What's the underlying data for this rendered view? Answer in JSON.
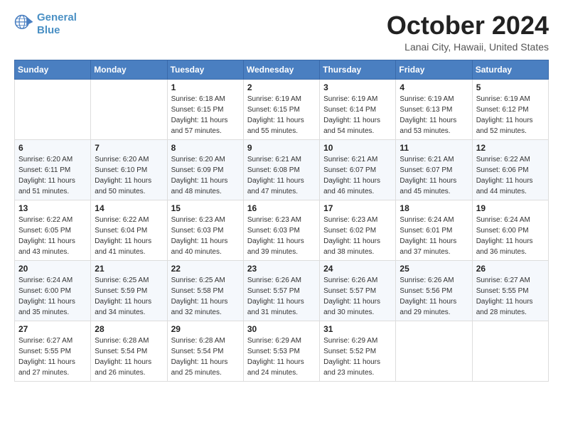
{
  "header": {
    "logo_line1": "General",
    "logo_line2": "Blue",
    "month_title": "October 2024",
    "subtitle": "Lanai City, Hawaii, United States"
  },
  "days_of_week": [
    "Sunday",
    "Monday",
    "Tuesday",
    "Wednesday",
    "Thursday",
    "Friday",
    "Saturday"
  ],
  "weeks": [
    [
      {
        "num": "",
        "detail": ""
      },
      {
        "num": "",
        "detail": ""
      },
      {
        "num": "1",
        "detail": "Sunrise: 6:18 AM\nSunset: 6:15 PM\nDaylight: 11 hours and 57 minutes."
      },
      {
        "num": "2",
        "detail": "Sunrise: 6:19 AM\nSunset: 6:15 PM\nDaylight: 11 hours and 55 minutes."
      },
      {
        "num": "3",
        "detail": "Sunrise: 6:19 AM\nSunset: 6:14 PM\nDaylight: 11 hours and 54 minutes."
      },
      {
        "num": "4",
        "detail": "Sunrise: 6:19 AM\nSunset: 6:13 PM\nDaylight: 11 hours and 53 minutes."
      },
      {
        "num": "5",
        "detail": "Sunrise: 6:19 AM\nSunset: 6:12 PM\nDaylight: 11 hours and 52 minutes."
      }
    ],
    [
      {
        "num": "6",
        "detail": "Sunrise: 6:20 AM\nSunset: 6:11 PM\nDaylight: 11 hours and 51 minutes."
      },
      {
        "num": "7",
        "detail": "Sunrise: 6:20 AM\nSunset: 6:10 PM\nDaylight: 11 hours and 50 minutes."
      },
      {
        "num": "8",
        "detail": "Sunrise: 6:20 AM\nSunset: 6:09 PM\nDaylight: 11 hours and 48 minutes."
      },
      {
        "num": "9",
        "detail": "Sunrise: 6:21 AM\nSunset: 6:08 PM\nDaylight: 11 hours and 47 minutes."
      },
      {
        "num": "10",
        "detail": "Sunrise: 6:21 AM\nSunset: 6:07 PM\nDaylight: 11 hours and 46 minutes."
      },
      {
        "num": "11",
        "detail": "Sunrise: 6:21 AM\nSunset: 6:07 PM\nDaylight: 11 hours and 45 minutes."
      },
      {
        "num": "12",
        "detail": "Sunrise: 6:22 AM\nSunset: 6:06 PM\nDaylight: 11 hours and 44 minutes."
      }
    ],
    [
      {
        "num": "13",
        "detail": "Sunrise: 6:22 AM\nSunset: 6:05 PM\nDaylight: 11 hours and 43 minutes."
      },
      {
        "num": "14",
        "detail": "Sunrise: 6:22 AM\nSunset: 6:04 PM\nDaylight: 11 hours and 41 minutes."
      },
      {
        "num": "15",
        "detail": "Sunrise: 6:23 AM\nSunset: 6:03 PM\nDaylight: 11 hours and 40 minutes."
      },
      {
        "num": "16",
        "detail": "Sunrise: 6:23 AM\nSunset: 6:03 PM\nDaylight: 11 hours and 39 minutes."
      },
      {
        "num": "17",
        "detail": "Sunrise: 6:23 AM\nSunset: 6:02 PM\nDaylight: 11 hours and 38 minutes."
      },
      {
        "num": "18",
        "detail": "Sunrise: 6:24 AM\nSunset: 6:01 PM\nDaylight: 11 hours and 37 minutes."
      },
      {
        "num": "19",
        "detail": "Sunrise: 6:24 AM\nSunset: 6:00 PM\nDaylight: 11 hours and 36 minutes."
      }
    ],
    [
      {
        "num": "20",
        "detail": "Sunrise: 6:24 AM\nSunset: 6:00 PM\nDaylight: 11 hours and 35 minutes."
      },
      {
        "num": "21",
        "detail": "Sunrise: 6:25 AM\nSunset: 5:59 PM\nDaylight: 11 hours and 34 minutes."
      },
      {
        "num": "22",
        "detail": "Sunrise: 6:25 AM\nSunset: 5:58 PM\nDaylight: 11 hours and 32 minutes."
      },
      {
        "num": "23",
        "detail": "Sunrise: 6:26 AM\nSunset: 5:57 PM\nDaylight: 11 hours and 31 minutes."
      },
      {
        "num": "24",
        "detail": "Sunrise: 6:26 AM\nSunset: 5:57 PM\nDaylight: 11 hours and 30 minutes."
      },
      {
        "num": "25",
        "detail": "Sunrise: 6:26 AM\nSunset: 5:56 PM\nDaylight: 11 hours and 29 minutes."
      },
      {
        "num": "26",
        "detail": "Sunrise: 6:27 AM\nSunset: 5:55 PM\nDaylight: 11 hours and 28 minutes."
      }
    ],
    [
      {
        "num": "27",
        "detail": "Sunrise: 6:27 AM\nSunset: 5:55 PM\nDaylight: 11 hours and 27 minutes."
      },
      {
        "num": "28",
        "detail": "Sunrise: 6:28 AM\nSunset: 5:54 PM\nDaylight: 11 hours and 26 minutes."
      },
      {
        "num": "29",
        "detail": "Sunrise: 6:28 AM\nSunset: 5:54 PM\nDaylight: 11 hours and 25 minutes."
      },
      {
        "num": "30",
        "detail": "Sunrise: 6:29 AM\nSunset: 5:53 PM\nDaylight: 11 hours and 24 minutes."
      },
      {
        "num": "31",
        "detail": "Sunrise: 6:29 AM\nSunset: 5:52 PM\nDaylight: 11 hours and 23 minutes."
      },
      {
        "num": "",
        "detail": ""
      },
      {
        "num": "",
        "detail": ""
      }
    ]
  ]
}
